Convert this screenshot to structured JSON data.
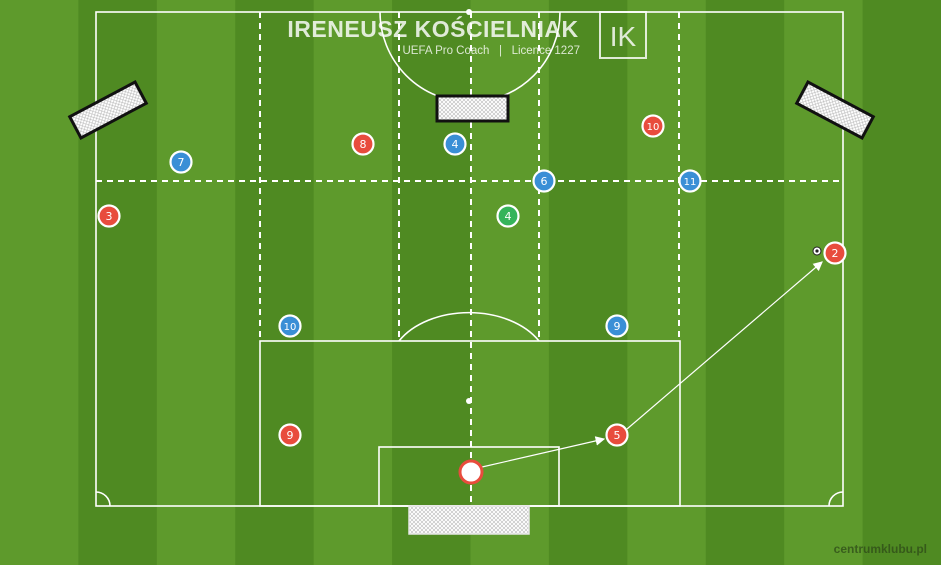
{
  "header": {
    "coach_name": "IRENEUSZ KOŚCIELNIAK",
    "subtitle": "UEFA Pro Coach   |   Licence 1227",
    "logo_letters": "IK"
  },
  "watermark": "centrumklubu.pl",
  "colors": {
    "grass_light": "#5e9a2c",
    "grass_dark": "#4f8a22",
    "line": "#ffffff",
    "team_red": "#e84c3d",
    "team_blue": "#3a8fd6",
    "neutral_green": "#35b45a",
    "arrow": "#ffffff"
  },
  "players": [
    {
      "team": "blue",
      "number": "7"
    },
    {
      "team": "red",
      "number": "8"
    },
    {
      "team": "blue",
      "number": "4"
    },
    {
      "team": "red",
      "number": "10"
    },
    {
      "team": "red",
      "number": "3"
    },
    {
      "team": "blue",
      "number": "6"
    },
    {
      "team": "blue",
      "number": "11"
    },
    {
      "team": "green",
      "number": "4"
    },
    {
      "team": "red",
      "number": "2"
    },
    {
      "team": "blue",
      "number": "10"
    },
    {
      "team": "blue",
      "number": "9"
    },
    {
      "team": "red",
      "number": "9"
    },
    {
      "team": "red",
      "number": "5"
    }
  ],
  "goalkeeper": {
    "team": "red",
    "number": ""
  },
  "icons": {
    "ball": "soccer-ball-icon",
    "goal": "goal-net-icon",
    "arrow": "pass-arrow-icon"
  }
}
